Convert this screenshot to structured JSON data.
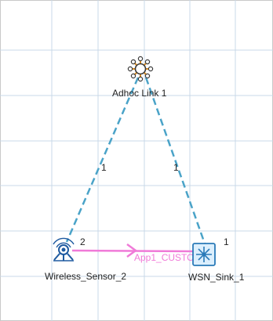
{
  "nodes": {
    "adhoc_link": {
      "label": "Adhoc Link 1",
      "icon": "adhoc-link-icon"
    },
    "wireless_sensor": {
      "label": "Wireless_Sensor_2",
      "icon": "wireless-sensor-icon"
    },
    "wsn_sink": {
      "label": "WSN_Sink_1",
      "icon": "wsn-sink-icon"
    }
  },
  "links": {
    "left": {
      "port_top": "1",
      "port_bottom": "2"
    },
    "right": {
      "port_top": "1",
      "port_bottom": "1"
    }
  },
  "application": {
    "label": "App1_CUSTOM"
  },
  "colors": {
    "grid": "#c8d8e8",
    "link": "#4aa3c8",
    "app_arrow": "#f07ad8",
    "sink_fill": "#dceffd",
    "sink_stroke": "#2a7ab8",
    "hub": "#d98b1f"
  }
}
